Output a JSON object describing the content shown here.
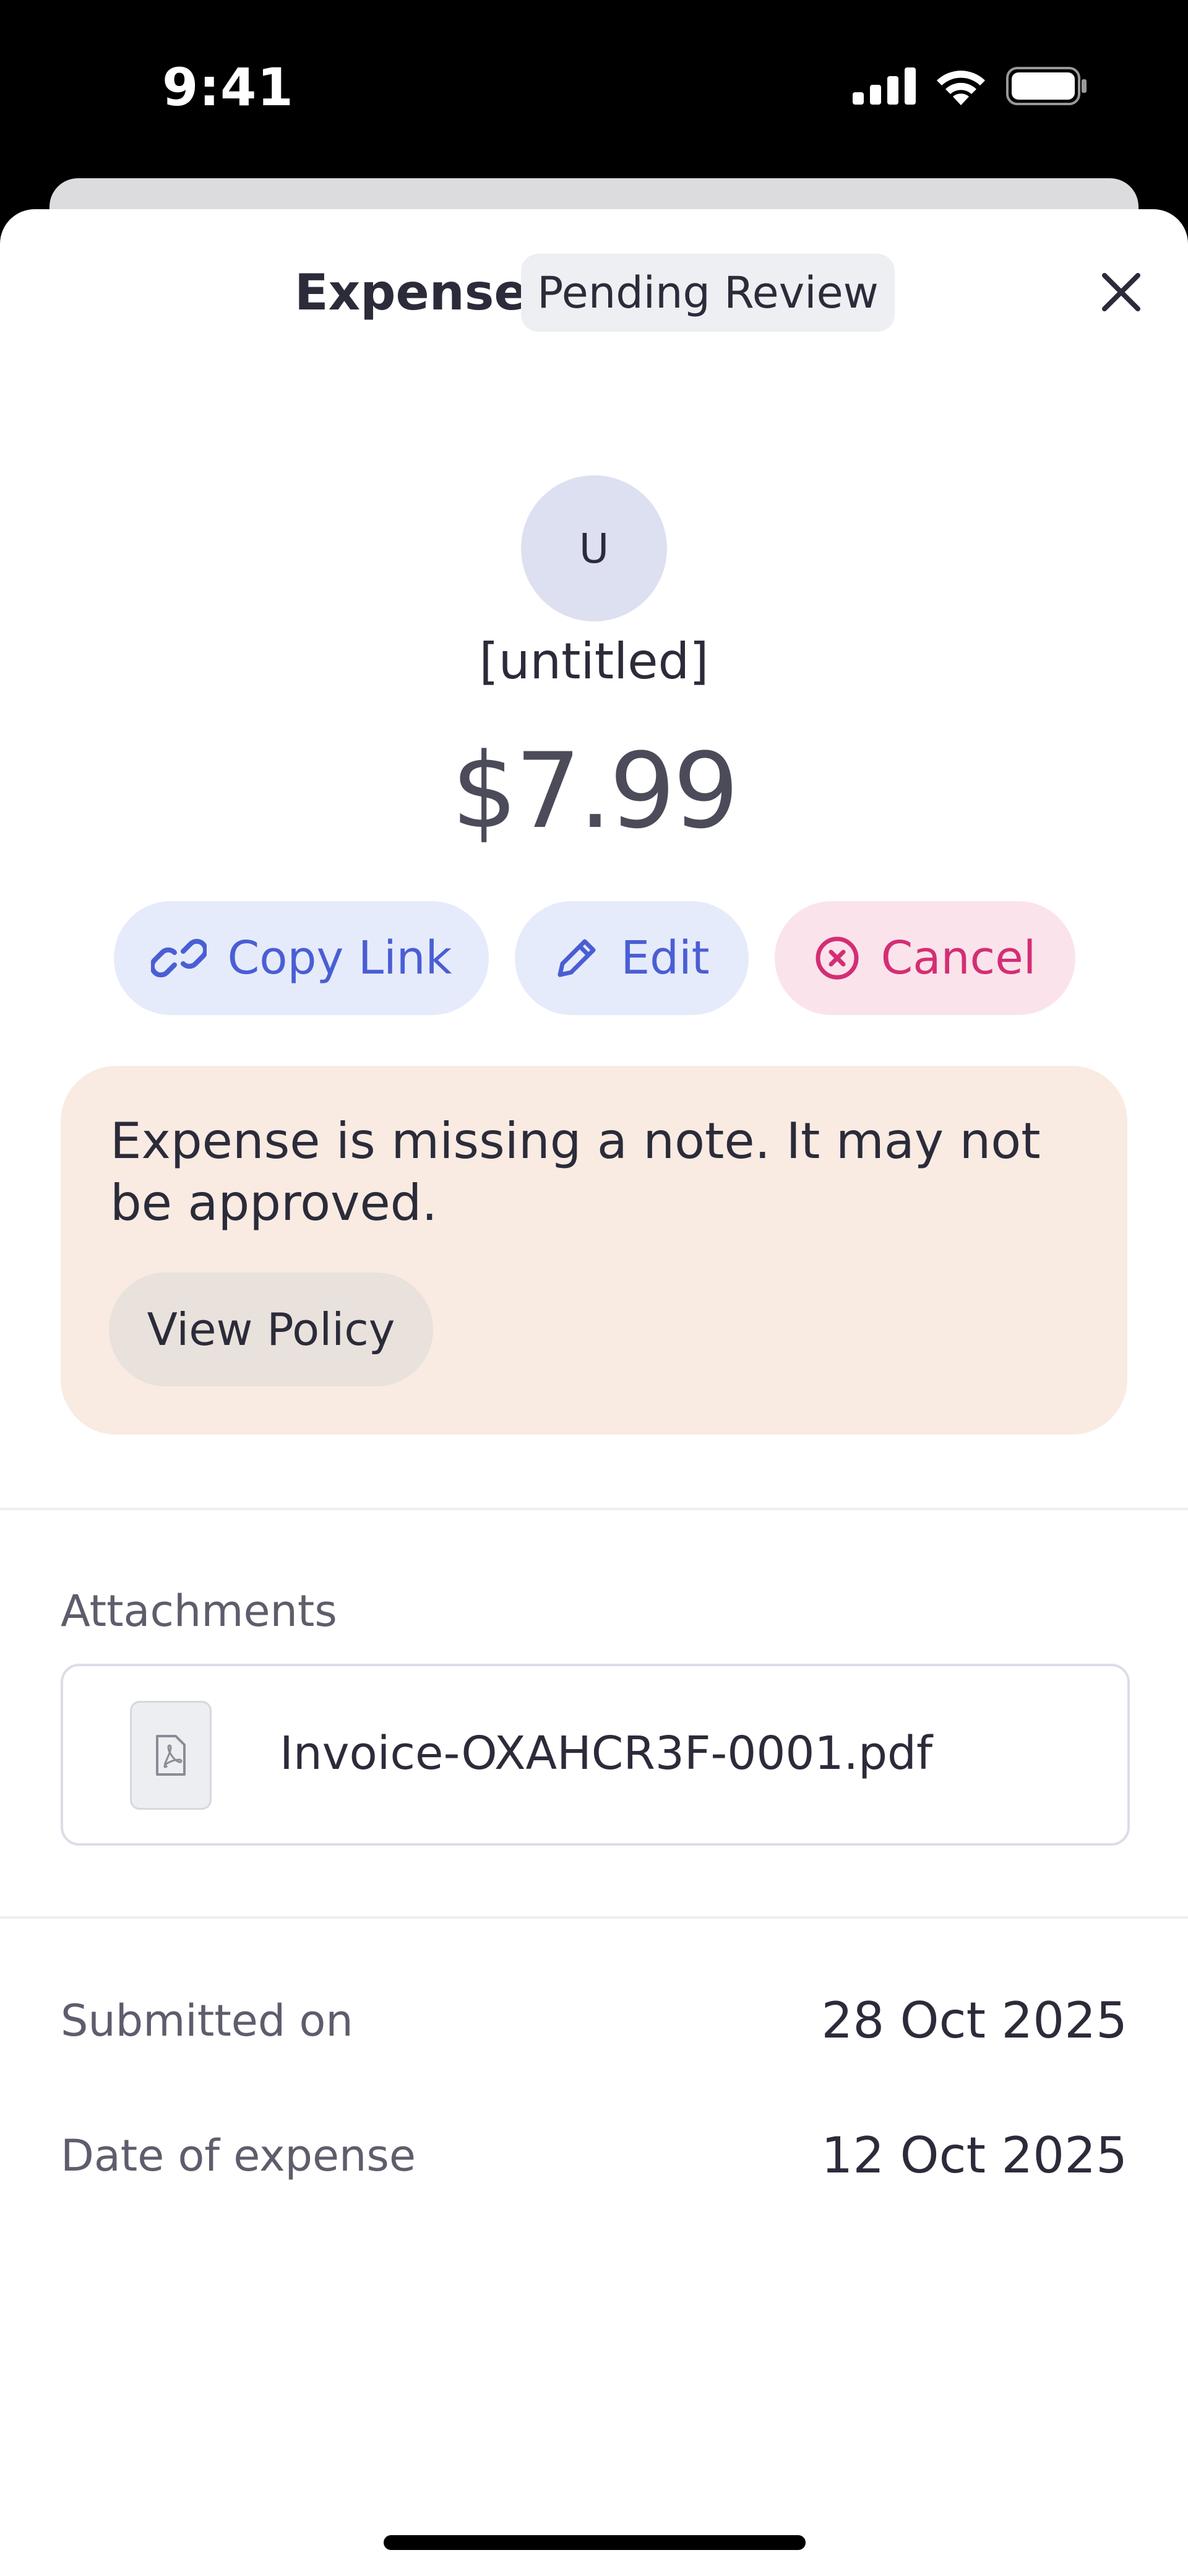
{
  "status_bar": {
    "time": "9:41"
  },
  "header": {
    "title": "Expense",
    "status_badge": "Pending Review"
  },
  "expense": {
    "avatar_initial": "U",
    "merchant": "[untitled]",
    "amount": "$7.99"
  },
  "actions": {
    "copy_link": "Copy Link",
    "edit": "Edit",
    "cancel": "Cancel"
  },
  "warning": {
    "message": "Expense is missing a note. It may not be approved.",
    "button": "View Policy"
  },
  "attachments": {
    "label": "Attachments",
    "files": [
      {
        "name": "Invoice-OXAHCR3F-0001.pdf",
        "icon": "pdf-file-icon"
      }
    ]
  },
  "details": {
    "submitted_label": "Submitted on",
    "submitted_value": "28 Oct 2025",
    "date_label": "Date of expense",
    "date_value": "12 Oct 2025"
  },
  "colors": {
    "accent_blue": "#4a5ed4",
    "cancel_pink": "#d42e74",
    "warning_bg": "#f9ebe2"
  }
}
